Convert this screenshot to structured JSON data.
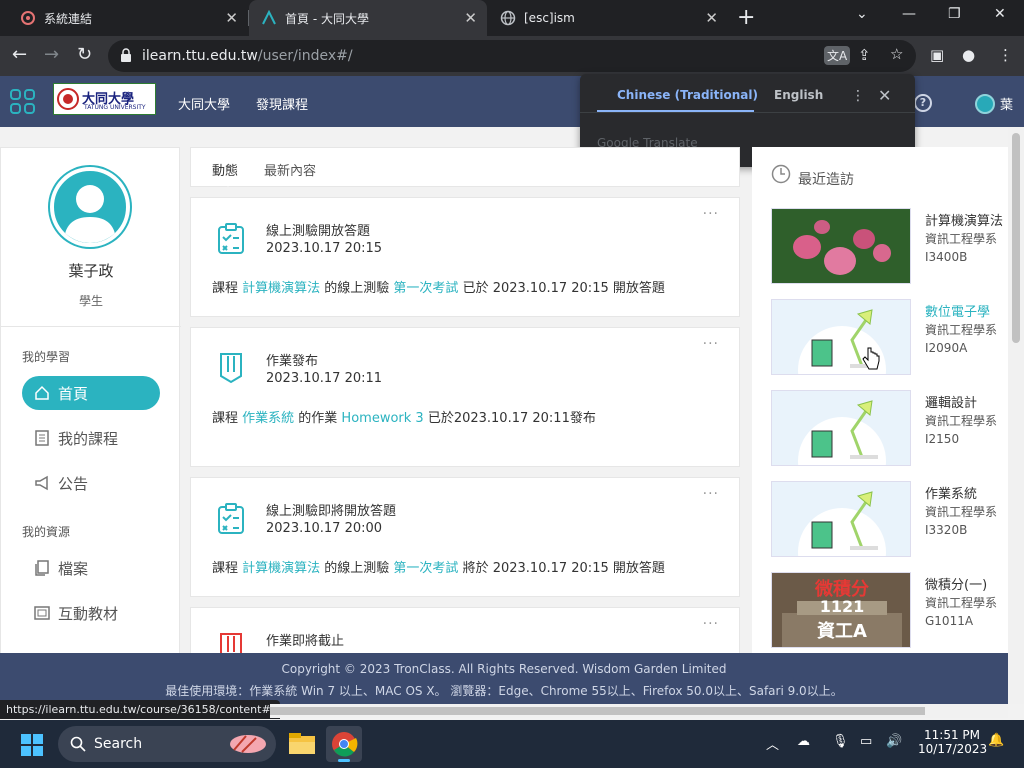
{
  "browser": {
    "tabs": [
      {
        "title": "系統連結"
      },
      {
        "title": "首頁 - 大同大學"
      },
      {
        "title": "[esc]ism"
      }
    ],
    "url_host": "ilearn.ttu.edu.tw",
    "url_path": "/user/index#/"
  },
  "translate_popup": {
    "lang_source": "Chinese (Traditional)",
    "lang_target": "English",
    "brand": "Google Translate"
  },
  "appbar": {
    "nav": [
      "大同大學",
      "發現課程"
    ],
    "user_initial": "葉"
  },
  "sidebar": {
    "name": "葉子政",
    "role": "學生",
    "section_learning": "我的學習",
    "items_learning": [
      {
        "label": "首頁",
        "icon": "home-icon"
      },
      {
        "label": "我的課程",
        "icon": "document-icon"
      },
      {
        "label": "公告",
        "icon": "megaphone-icon"
      }
    ],
    "section_resources": "我的資源",
    "items_resources": [
      {
        "label": "檔案",
        "icon": "files-icon"
      },
      {
        "label": "互動教材",
        "icon": "interactive-material-icon"
      }
    ]
  },
  "feed": {
    "tabs": [
      "動態",
      "最新內容"
    ],
    "cards": [
      {
        "title": "線上測驗開放答題",
        "time": "2023.10.17 20:15",
        "d1": "課程 ",
        "l1": "計算機演算法",
        "d2": " 的線上測驗 ",
        "l2": "第一次考試",
        "d3": " 已於 2023.10.17 20:15 開放答題"
      },
      {
        "title": "作業發布",
        "time": "2023.10.17 20:11",
        "d1": "課程 ",
        "l1": "作業系統",
        "d2": " 的作業 ",
        "l2": "Homework 3",
        "d3": " 已於2023.10.17 20:11發布"
      },
      {
        "title": "線上測驗即將開放答題",
        "time": "2023.10.17 20:00",
        "d1": "課程 ",
        "l1": "計算機演算法",
        "d2": " 的線上測驗 ",
        "l2": "第一次考試",
        "d3": " 將於 2023.10.17 20:15 開放答題"
      },
      {
        "title": "作業即將截止"
      }
    ]
  },
  "recent": {
    "title": "最近造訪",
    "courses": [
      {
        "name": "計算機演算法",
        "dept": "資訊工程學系",
        "code": "I3400B"
      },
      {
        "name": "數位電子學",
        "dept": "資訊工程學系",
        "code": "I2090A"
      },
      {
        "name": "邏輯設計",
        "dept": "資訊工程學系",
        "code": "I2150"
      },
      {
        "name": "作業系統",
        "dept": "資訊工程學系",
        "code": "I3320B"
      },
      {
        "name": "微積分(一)",
        "dept": "資訊工程學系",
        "code": "G1011A"
      }
    ],
    "thumb_text": {
      "line1": "微積分",
      "line2": "1121",
      "line3": "資工A"
    }
  },
  "footer": {
    "copyright": "Copyright © 2023 TronClass. All Rights Reserved. Wisdom Garden Limited",
    "env": "最佳使用環境：作業系統 Win 7 以上、MAC OS X。 瀏覽器：Edge、Chrome 55以上、Firefox 50.0以上、Safari 9.0以上。"
  },
  "status_url": "https://ilearn.ttu.edu.tw/course/36158/content#/",
  "taskbar": {
    "search": "Search",
    "time": "11:51 PM",
    "date": "10/17/2023"
  },
  "colors": {
    "accent": "#2bb3c0",
    "appbar": "#3c4b6f"
  }
}
